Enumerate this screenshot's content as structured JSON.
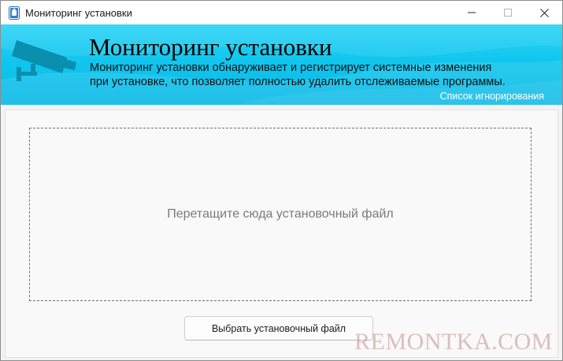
{
  "window": {
    "title": "Мониторинг установки",
    "controls": {
      "minimize": "minimize-icon",
      "maximize": "maximize-icon",
      "close": "close-icon"
    }
  },
  "banner": {
    "title": "Мониторинг установки",
    "description_lines": [
      "Мониторинг установки обнаруживает и регистрирует системные изменения",
      "при установке, что позволяет полностью удалить отслеживаемые программы."
    ],
    "ignore_list_link": "Список игнорирования",
    "icon": "security-camera-icon",
    "colors": {
      "gradient_top": "#2fd4f5",
      "gradient_bottom": "#08b8e6",
      "camera": "#0a8fae"
    }
  },
  "main": {
    "dropzone_text": "Перетащите сюда установочный файл",
    "select_button_label": "Выбрать установочный файл"
  },
  "watermark": "REMONTKA.COM"
}
